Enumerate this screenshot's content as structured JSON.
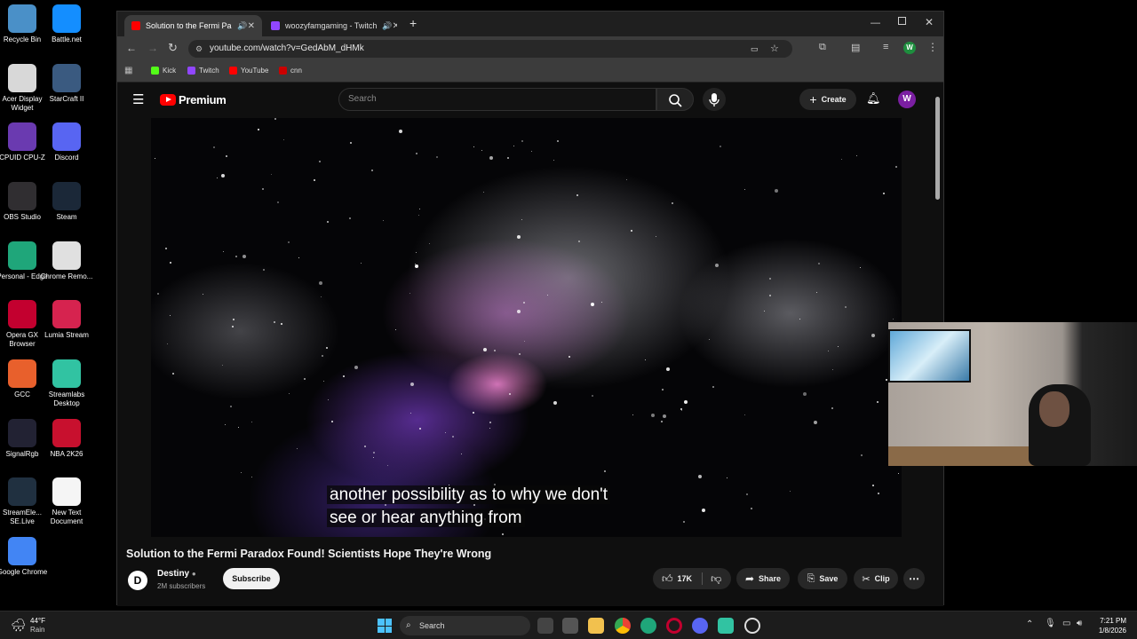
{
  "desktop": {
    "icons": [
      {
        "label": "Recycle Bin",
        "color": "#4a90c8"
      },
      {
        "label": "Battle.net",
        "color": "#148eff"
      },
      {
        "label": "Acer Display Widget",
        "color": "#d8d8d8"
      },
      {
        "label": "StarCraft II",
        "color": "#3a5a80"
      },
      {
        "label": "CPUID CPU-Z",
        "color": "#6a3ab0"
      },
      {
        "label": "Discord",
        "color": "#5865f2"
      },
      {
        "label": "OBS Studio",
        "color": "#302e31"
      },
      {
        "label": "Steam",
        "color": "#1b2838"
      },
      {
        "label": "Personal - Edge",
        "color": "#1fa67a"
      },
      {
        "label": "Chrome Remo...",
        "color": "#e0e0e0"
      },
      {
        "label": "Opera GX Browser",
        "color": "#c3002f"
      },
      {
        "label": "Lumia Stream",
        "color": "#d6234f"
      },
      {
        "label": "GCC",
        "color": "#e8602c"
      },
      {
        "label": "Streamlabs Desktop",
        "color": "#31c3a2"
      },
      {
        "label": "SignalRgb",
        "color": "#222233"
      },
      {
        "label": "NBA 2K26",
        "color": "#c8102e"
      },
      {
        "label": "StreamEle... SE.Live",
        "color": "#203040"
      },
      {
        "label": "New Text Document",
        "color": "#f5f5f5"
      },
      {
        "label": "Google Chrome",
        "color": "#4285f4"
      }
    ]
  },
  "browser": {
    "tabs": [
      {
        "title": "Solution to the Fermi Parad",
        "favicon_color": "#ff0000",
        "active": true
      },
      {
        "title": "woozyfamgaming - Twitch",
        "favicon_color": "#9146ff",
        "active": false
      }
    ],
    "new_tab": "+",
    "url": "youtube.com/watch?v=GedAbM_dHMk",
    "profile_initial": "W",
    "bookmarks": [
      {
        "label": "Kick",
        "color": "#53fc18"
      },
      {
        "label": "Twitch",
        "color": "#9146ff"
      },
      {
        "label": "YouTube",
        "color": "#ff0000"
      },
      {
        "label": "cnn",
        "color": "#cc0000"
      }
    ]
  },
  "youtube": {
    "logo_text": "Premium",
    "search_placeholder": "Search",
    "create_label": "Create",
    "avatar_initial": "W",
    "caption_line1": "another possibility as to why we don't",
    "caption_line2": "see or hear anything from",
    "video_title": "Solution to the Fermi Paradox Found! Scientists Hope They're Wrong",
    "channel_name": "Destiny",
    "subscribers": "2M subscribers",
    "subscribe_label": "Subscribe",
    "likes": "17K",
    "share_label": "Share",
    "save_label": "Save",
    "clip_label": "Clip"
  },
  "taskbar": {
    "weather_temp": "44°F",
    "weather_desc": "Rain",
    "search_label": "Search",
    "time": "7:21 PM",
    "date": "1/8/2026"
  }
}
